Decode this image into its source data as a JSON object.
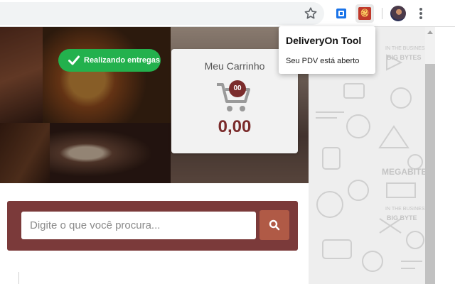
{
  "browser": {
    "toolbar_icons": [
      "star-icon",
      "extension-icon",
      "deliveryon-extension-icon",
      "profile-avatar",
      "more-vert-icon"
    ],
    "deliveryon_icon_glyph": "㊗"
  },
  "popup": {
    "title": "DeliveryOn Tool",
    "message": "Seu PDV está aberto"
  },
  "hero": {
    "status_label": "Realizando entregas"
  },
  "cart": {
    "title": "Meu Carrinho",
    "count": "00",
    "total": "0,00"
  },
  "search": {
    "placeholder": "Digite o que você procura...",
    "button_icon": "search-icon"
  },
  "pattern": {
    "texts": [
      "IN THE BUSINES",
      "BIG BYTES",
      "MEGABITES",
      "IN THE BUSINES",
      "BIG BYTE"
    ]
  },
  "colors": {
    "status_green": "#23b14d",
    "brand_maroon": "#7b2c2c",
    "search_bar": "#7b3a3a",
    "search_button": "#b05a46"
  }
}
